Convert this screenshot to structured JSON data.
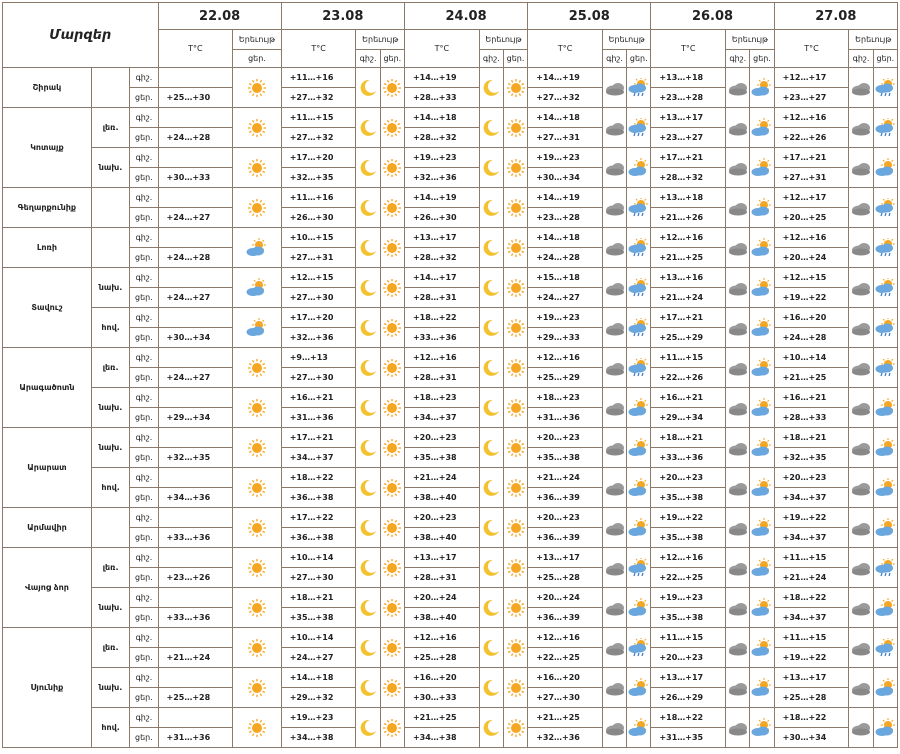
{
  "header": {
    "region": "Մարզեր",
    "temp": "T°C",
    "phen": "Երեւույթ",
    "day": "ցեր.",
    "night": "գիշ.",
    "dates": [
      "22.08",
      "23.08",
      "24.08",
      "25.08",
      "26.08",
      "27.08"
    ]
  },
  "regions": [
    {
      "name": "Շիրակ",
      "subs": [
        {
          "name": "",
          "rows": [
            {
              "tod": "գիշ.",
              "t": [
                "",
                "+11…+16",
                "+14…+19",
                "+14…+19",
                "+13…+18",
                "+12…+17"
              ],
              "i": [
                "sun",
                "moon",
                "moon",
                "cloud",
                "cloud",
                "cloud",
                "cloud"
              ]
            },
            {
              "tod": "ցեր.",
              "t": [
                "+25…+30",
                "+27…+32",
                "+28…+33",
                "+27…+32",
                "+23…+28",
                "+23…+27"
              ],
              "i": [
                "sun",
                "sun",
                "sun",
                "cloudsunrain",
                "cloudsun",
                "cloudsunrain"
              ]
            }
          ]
        }
      ]
    },
    {
      "name": "Կոտայք",
      "subs": [
        {
          "name": "լեռ.",
          "rows": [
            {
              "tod": "գիշ.",
              "t": [
                "",
                "+11…+15",
                "+14…+18",
                "+14…+18",
                "+13…+17",
                "+12…+16"
              ],
              "i": [
                "sun",
                "moon",
                "moon",
                "cloud",
                "cloud",
                "cloud",
                "cloud"
              ]
            },
            {
              "tod": "ցեր.",
              "t": [
                "+24…+28",
                "+27…+32",
                "+28…+32",
                "+27…+31",
                "+23…+27",
                "+22…+26"
              ],
              "i": [
                "sun",
                "sun",
                "sun",
                "cloudsunrain",
                "cloudsun",
                "cloudsunrain"
              ]
            }
          ]
        },
        {
          "name": "նախ.",
          "rows": [
            {
              "tod": "գիշ.",
              "t": [
                "",
                "+17…+20",
                "+19…+23",
                "+19…+23",
                "+17…+21",
                "+17…+21"
              ],
              "i": [
                "sun",
                "moon",
                "moon",
                "cloud",
                "cloud",
                "cloud",
                "cloud"
              ]
            },
            {
              "tod": "ցեր.",
              "t": [
                "+30…+33",
                "+32…+35",
                "+32…+36",
                "+30…+34",
                "+28…+32",
                "+27…+31"
              ],
              "i": [
                "sun",
                "sun",
                "sun",
                "cloudsun",
                "cloudsun",
                "cloudsun"
              ]
            }
          ]
        }
      ]
    },
    {
      "name": "Գեղարքունիք",
      "subs": [
        {
          "name": "",
          "rows": [
            {
              "tod": "գիշ.",
              "t": [
                "",
                "+11…+16",
                "+14…+19",
                "+14…+19",
                "+13…+18",
                "+12…+17"
              ],
              "i": [
                "sun",
                "moon",
                "moon",
                "cloud",
                "cloud",
                "cloud",
                "cloud"
              ]
            },
            {
              "tod": "ցեր.",
              "t": [
                "+24…+27",
                "+26…+30",
                "+26…+30",
                "+23…+28",
                "+21…+26",
                "+20…+25"
              ],
              "i": [
                "sun",
                "sun",
                "sun",
                "cloudsunrain",
                "cloudsun",
                "cloudsunrain"
              ]
            }
          ]
        }
      ]
    },
    {
      "name": "Լոռի",
      "subs": [
        {
          "name": "",
          "rows": [
            {
              "tod": "գիշ.",
              "t": [
                "",
                "+10…+15",
                "+13…+17",
                "+14…+18",
                "+12…+16",
                "+12…+16"
              ],
              "i": [
                "cloudsun",
                "moon",
                "moon",
                "cloud",
                "cloud",
                "cloud",
                "cloud"
              ]
            },
            {
              "tod": "ցեր.",
              "t": [
                "+24…+28",
                "+27…+31",
                "+28…+32",
                "+24…+28",
                "+21…+25",
                "+20…+24"
              ],
              "i": [
                "sun",
                "sun",
                "sun",
                "cloudsunrain",
                "cloudsun",
                "cloudsunrain"
              ]
            }
          ]
        }
      ]
    },
    {
      "name": "Տավուշ",
      "subs": [
        {
          "name": "նախ.",
          "rows": [
            {
              "tod": "գիշ.",
              "t": [
                "",
                "+12…+15",
                "+14…+17",
                "+15…+18",
                "+13…+16",
                "+12…+15"
              ],
              "i": [
                "cloudsun",
                "moon",
                "moon",
                "cloud",
                "cloud",
                "cloud",
                "cloud"
              ]
            },
            {
              "tod": "ցեր.",
              "t": [
                "+24…+27",
                "+27…+30",
                "+28…+31",
                "+24…+27",
                "+21…+24",
                "+19…+22"
              ],
              "i": [
                "sun",
                "sun",
                "sun",
                "cloudsunrain",
                "cloudsun",
                "cloudsunrain"
              ]
            }
          ]
        },
        {
          "name": "հով.",
          "rows": [
            {
              "tod": "գիշ.",
              "t": [
                "",
                "+17…+20",
                "+18…+22",
                "+19…+23",
                "+17…+21",
                "+16…+20"
              ],
              "i": [
                "cloudsun",
                "moon",
                "moon",
                "cloud",
                "cloud",
                "cloud",
                "cloud"
              ]
            },
            {
              "tod": "ցեր.",
              "t": [
                "+30…+34",
                "+32…+36",
                "+33…+36",
                "+29…+33",
                "+25…+29",
                "+24…+28"
              ],
              "i": [
                "sun",
                "sun",
                "sun",
                "cloudsunrain",
                "cloudsun",
                "cloudsunrain"
              ]
            }
          ]
        }
      ]
    },
    {
      "name": "Արագածոտն",
      "subs": [
        {
          "name": "լեռ.",
          "rows": [
            {
              "tod": "գիշ.",
              "t": [
                "",
                "+9…+13",
                "+12…+16",
                "+12…+16",
                "+11…+15",
                "+10…+14"
              ],
              "i": [
                "sun",
                "moon",
                "moon",
                "cloud",
                "cloud",
                "cloud",
                "cloud"
              ]
            },
            {
              "tod": "ցեր.",
              "t": [
                "+24…+27",
                "+27…+30",
                "+28…+31",
                "+25…+29",
                "+22…+26",
                "+21…+25"
              ],
              "i": [
                "sun",
                "sun",
                "sun",
                "cloudsunrain",
                "cloudsun",
                "cloudsunrain"
              ]
            }
          ]
        },
        {
          "name": "նախ.",
          "rows": [
            {
              "tod": "գիշ.",
              "t": [
                "",
                "+16…+21",
                "+18…+23",
                "+18…+23",
                "+16…+21",
                "+16…+21"
              ],
              "i": [
                "sun",
                "moon",
                "moon",
                "cloud",
                "cloud",
                "cloud",
                "cloud"
              ]
            },
            {
              "tod": "ցեր.",
              "t": [
                "+29…+34",
                "+31…+36",
                "+34…+37",
                "+31…+36",
                "+29…+34",
                "+28…+33"
              ],
              "i": [
                "sun",
                "sun",
                "sun",
                "cloudsun",
                "cloudsun",
                "cloudsun"
              ]
            }
          ]
        }
      ]
    },
    {
      "name": "Արարատ",
      "subs": [
        {
          "name": "նախ.",
          "rows": [
            {
              "tod": "գիշ.",
              "t": [
                "",
                "+17…+21",
                "+20…+23",
                "+20…+23",
                "+18…+21",
                "+18…+21"
              ],
              "i": [
                "sun",
                "moon",
                "moon",
                "cloud",
                "cloud",
                "cloud",
                "cloud"
              ]
            },
            {
              "tod": "ցեր.",
              "t": [
                "+32…+35",
                "+34…+37",
                "+35…+38",
                "+35…+38",
                "+33…+36",
                "+32…+35"
              ],
              "i": [
                "sun",
                "sun",
                "sun",
                "cloudsun",
                "cloudsun",
                "cloudsun"
              ]
            }
          ]
        },
        {
          "name": "հով.",
          "rows": [
            {
              "tod": "գիշ.",
              "t": [
                "",
                "+18…+22",
                "+21…+24",
                "+21…+24",
                "+20…+23",
                "+20…+23"
              ],
              "i": [
                "sun",
                "moon",
                "moon",
                "cloud",
                "cloud",
                "cloud",
                "cloud"
              ]
            },
            {
              "tod": "ցեր.",
              "t": [
                "+34…+36",
                "+36…+38",
                "+38…+40",
                "+36…+39",
                "+35…+38",
                "+34…+37"
              ],
              "i": [
                "sun",
                "sun",
                "sun",
                "cloudsun",
                "cloudsun",
                "cloudsun"
              ]
            }
          ]
        }
      ]
    },
    {
      "name": "Արմավիր",
      "subs": [
        {
          "name": "",
          "rows": [
            {
              "tod": "գիշ.",
              "t": [
                "",
                "+17…+22",
                "+20…+23",
                "+20…+23",
                "+19…+22",
                "+19…+22"
              ],
              "i": [
                "sun",
                "moon",
                "moon",
                "cloud",
                "cloud",
                "cloud",
                "cloud"
              ]
            },
            {
              "tod": "ցեր.",
              "t": [
                "+33…+36",
                "+36…+38",
                "+38…+40",
                "+36…+39",
                "+35…+38",
                "+34…+37"
              ],
              "i": [
                "sun",
                "sun",
                "sun",
                "cloudsun",
                "cloudsun",
                "cloudsun"
              ]
            }
          ]
        }
      ]
    },
    {
      "name": "Վայոց ձոր",
      "subs": [
        {
          "name": "լեռ.",
          "rows": [
            {
              "tod": "գիշ.",
              "t": [
                "",
                "+10…+14",
                "+13…+17",
                "+13…+17",
                "+12…+16",
                "+11…+15"
              ],
              "i": [
                "sun",
                "moon",
                "moon",
                "cloud",
                "cloud",
                "cloud",
                "cloud"
              ]
            },
            {
              "tod": "ցեր.",
              "t": [
                "+23…+26",
                "+27…+30",
                "+28…+31",
                "+25…+28",
                "+22…+25",
                "+21…+24"
              ],
              "i": [
                "sun",
                "sun",
                "sun",
                "cloudsunrain",
                "cloudsun",
                "cloudsunrain"
              ]
            }
          ]
        },
        {
          "name": "նախ.",
          "rows": [
            {
              "tod": "գիշ.",
              "t": [
                "",
                "+18…+21",
                "+20…+24",
                "+20…+24",
                "+19…+23",
                "+18…+22"
              ],
              "i": [
                "sun",
                "moon",
                "moon",
                "cloud",
                "cloud",
                "cloud",
                "cloud"
              ]
            },
            {
              "tod": "ցեր.",
              "t": [
                "+33…+36",
                "+35…+38",
                "+38…+40",
                "+36…+39",
                "+35…+38",
                "+34…+37"
              ],
              "i": [
                "sun",
                "sun",
                "sun",
                "cloudsun",
                "cloudsun",
                "cloudsun"
              ]
            }
          ]
        }
      ]
    },
    {
      "name": "Սյունիք",
      "subs": [
        {
          "name": "լեռ.",
          "rows": [
            {
              "tod": "գիշ.",
              "t": [
                "",
                "+10…+14",
                "+12…+16",
                "+12…+16",
                "+11…+15",
                "+11…+15"
              ],
              "i": [
                "sun",
                "moon",
                "moon",
                "cloud",
                "cloud",
                "cloud",
                "cloud"
              ]
            },
            {
              "tod": "ցեր.",
              "t": [
                "+21…+24",
                "+24…+27",
                "+25…+28",
                "+22…+25",
                "+20…+23",
                "+19…+22"
              ],
              "i": [
                "sun",
                "sun",
                "sun",
                "cloudsunrain",
                "cloudsun",
                "cloudsunrain"
              ]
            }
          ]
        },
        {
          "name": "նախ.",
          "rows": [
            {
              "tod": "գիշ.",
              "t": [
                "",
                "+14…+18",
                "+16…+20",
                "+16…+20",
                "+13…+17",
                "+13…+17"
              ],
              "i": [
                "sun",
                "moon",
                "moon",
                "cloud",
                "cloud",
                "cloud",
                "cloud"
              ]
            },
            {
              "tod": "ցեր.",
              "t": [
                "+25…+28",
                "+29…+32",
                "+30…+33",
                "+27…+30",
                "+26…+29",
                "+25…+28"
              ],
              "i": [
                "sun",
                "sun",
                "sun",
                "cloudsun",
                "cloudsun",
                "cloudsun"
              ]
            }
          ]
        },
        {
          "name": "հով.",
          "rows": [
            {
              "tod": "գիշ.",
              "t": [
                "",
                "+19…+23",
                "+21…+25",
                "+21…+25",
                "+18…+22",
                "+18…+22"
              ],
              "i": [
                "sun",
                "moon",
                "moon",
                "cloud",
                "cloud",
                "cloud",
                "cloud"
              ]
            },
            {
              "tod": "ցեր.",
              "t": [
                "+31…+36",
                "+34…+38",
                "+34…+38",
                "+32…+36",
                "+31…+35",
                "+30…+34"
              ],
              "i": [
                "sun",
                "sun",
                "sun",
                "cloudsun",
                "cloudsun",
                "cloudsun"
              ]
            }
          ]
        }
      ]
    }
  ],
  "icons": {
    "sun": "sun-icon",
    "moon": "moon-icon",
    "cloud": "cloud-icon",
    "cloudsun": "cloud-sun-icon",
    "cloudsunrain": "cloud-sun-rain-icon"
  },
  "colors": {
    "border": "#8a7a6a",
    "sun": "#f5a623",
    "moon": "#f2c230",
    "cloud": "#9a9a9a",
    "rain": "#3a78c8",
    "cloud_blue": "#6aa7de"
  }
}
